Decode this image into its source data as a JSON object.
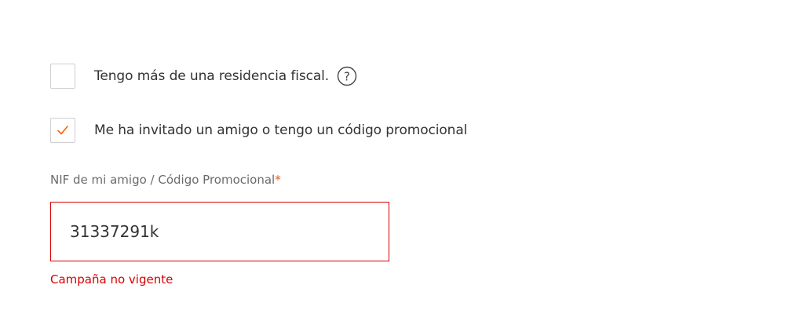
{
  "options": {
    "fiscal_residence": {
      "label": "Tengo más de una residencia fiscal.",
      "checked": false,
      "help_icon": "question-circle-icon"
    },
    "promo": {
      "label": "Me ha invitado un amigo o tengo un código promocional",
      "checked": true,
      "check_icon": "checkmark-icon"
    }
  },
  "promo_field": {
    "label": "NIF de mi amigo / Código Promocional",
    "required_mark": "*",
    "value": "31337291k",
    "error": "Campaña no vigente"
  },
  "colors": {
    "accent": "#ff6200",
    "error": "#d70000",
    "checkbox_border": "#cfcfcf",
    "text": "#333333",
    "label_muted": "#6a6a6a"
  }
}
